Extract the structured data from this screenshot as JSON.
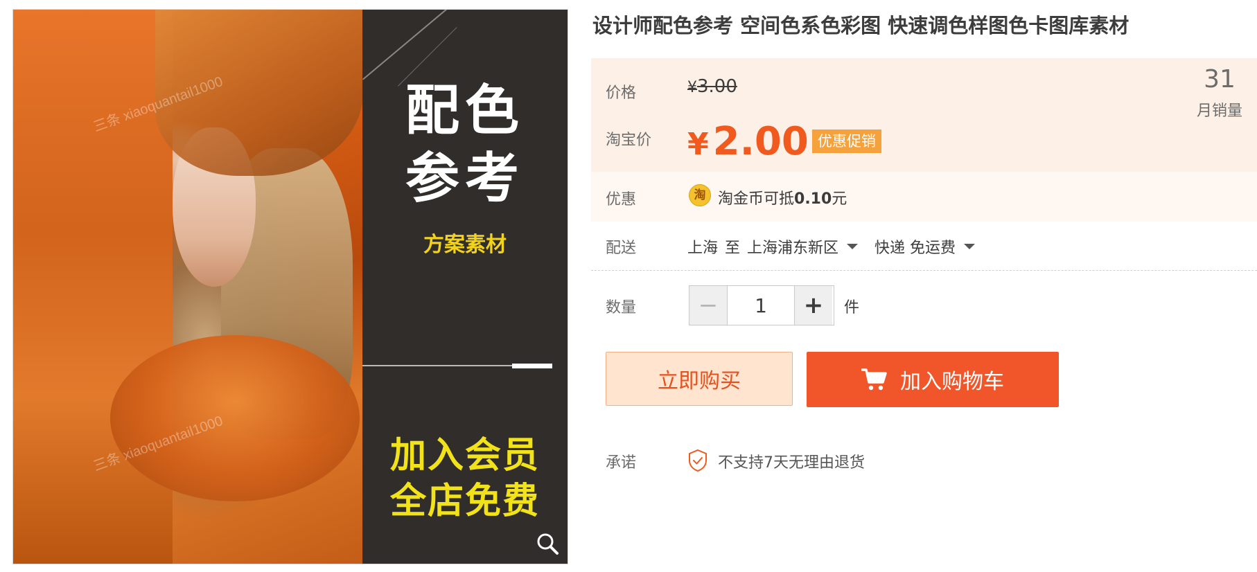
{
  "product_image": {
    "panel_title_line1": "配色",
    "panel_title_line2": "参考",
    "panel_subtitle": "方案素材",
    "member_line1": "加入会员",
    "member_line2": "全店免费",
    "watermark_top": "三条 xiaoquantail1000",
    "watermark_bottom": "三条 xiaoquantail1000"
  },
  "title": "设计师配色参考 空间色系色彩图 快速调色样图色卡图库素材",
  "price": {
    "label": "价格",
    "currency": "¥",
    "original": "3.00",
    "taobao_label": "淘宝价",
    "sale": "2.00",
    "promo_tag": "优惠促销"
  },
  "sales": {
    "count": "31",
    "label": "月销量"
  },
  "promotion": {
    "label": "优惠",
    "coin_icon_char": "淘",
    "text": "淘金币可抵",
    "amount": "0.10",
    "unit": "元"
  },
  "delivery": {
    "label": "配送",
    "from": "上海",
    "to_word": "至",
    "destination": "上海浦东新区",
    "method": "快递 免运费"
  },
  "quantity": {
    "label": "数量",
    "minus": "−",
    "value": "1",
    "plus": "+",
    "unit": "件"
  },
  "buttons": {
    "buy_now": "立即购买",
    "add_to_cart": "加入购物车"
  },
  "promise": {
    "label": "承诺",
    "text": "不支持7天无理由退货"
  },
  "colors": {
    "accent": "#f05a1f",
    "price_bg": "#fdf0e6",
    "promo_tag": "#f5a13c",
    "panel_dark": "#302d2b",
    "panel_yellow": "#f2e21a"
  },
  "icons": [
    "zoom-icon",
    "coin-icon",
    "chevron-down-icon",
    "minus-icon",
    "plus-icon",
    "cart-icon",
    "shield-check-icon"
  ]
}
